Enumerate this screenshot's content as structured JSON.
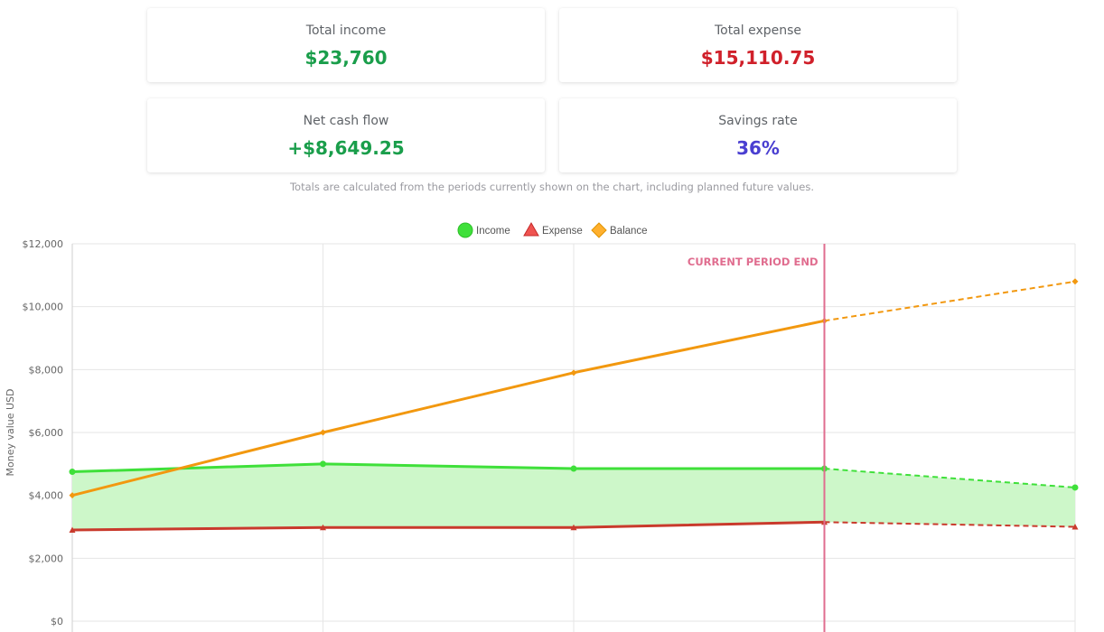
{
  "summary": {
    "income_label": "Total income",
    "income_value": "$23,760",
    "expense_label": "Total expense",
    "expense_value": "$15,110.75",
    "net_label": "Net cash flow",
    "net_value": "+$8,649.25",
    "savings_label": "Savings rate",
    "savings_value": "36%",
    "note": "Totals are calculated from the periods currently shown on the chart, including planned future values."
  },
  "colors": {
    "positive": "#1a9e4b",
    "negative": "#d0202a",
    "savings": "#4a3fd1",
    "income_line": "#3fe03a",
    "income_fill": "#cdf7c9",
    "expense_line": "#c93a2c",
    "balance_line": "#f2980f",
    "marker_line": "#e06d8f"
  },
  "chart_data": {
    "type": "line",
    "ylabel": "Money value USD",
    "ylim": [
      0,
      12000
    ],
    "yticks": [
      0,
      2000,
      4000,
      6000,
      8000,
      10000,
      12000
    ],
    "ytick_labels": [
      "$0",
      "$2,000",
      "$4,000",
      "$6,000",
      "$8,000",
      "$10,000",
      "$12,000"
    ],
    "x": [
      0,
      1,
      2,
      3,
      4
    ],
    "grid": true,
    "legend_placement": "top",
    "current_period_index": 3,
    "marker_label": "CURRENT PERIOD END",
    "series": [
      {
        "name": "Income",
        "values": [
          4750,
          5000,
          4850,
          4850,
          4250
        ],
        "marker": "circle"
      },
      {
        "name": "Expense",
        "values": [
          2900,
          2980,
          2980,
          3150,
          3000
        ],
        "marker": "triangle"
      },
      {
        "name": "Balance",
        "values": [
          4000,
          6000,
          7900,
          9550,
          10800
        ],
        "marker": "diamond"
      }
    ]
  }
}
